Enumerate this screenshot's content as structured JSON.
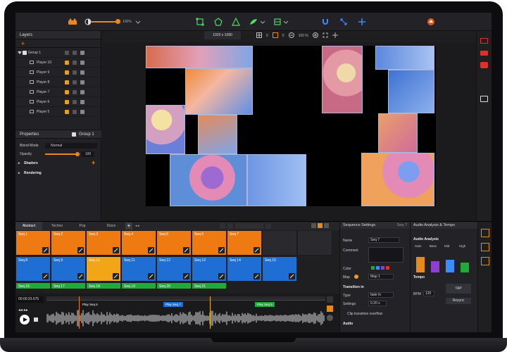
{
  "toolbar": {
    "zoom_percent": "100%",
    "resolution": "1920 x 1080",
    "canvas_zoom": "100 %",
    "x_label": "0",
    "y_label": "0",
    "tools": [
      "rect-tool-icon",
      "polygon-tool-icon",
      "triangle-tool-icon",
      "mask-tool-icon",
      "transform-tool-icon"
    ],
    "accent": "#e88a1a",
    "tool_color": "#4cd964",
    "snap_color": "#3b8cff"
  },
  "layers": {
    "title": "Layers",
    "group": {
      "name": "Group 1"
    },
    "items": [
      {
        "name": "Player 10"
      },
      {
        "name": "Player 9"
      },
      {
        "name": "Player 8"
      },
      {
        "name": "Player 7"
      },
      {
        "name": "Player 6"
      },
      {
        "name": "Player 5"
      }
    ]
  },
  "properties": {
    "title": "Properties",
    "target": "Group 1",
    "blend_mode_label": "Blend Mode",
    "blend_mode": "Normal",
    "opacity_label": "Opacity",
    "opacity": "100",
    "opacity_fraction": 1.0,
    "shaders": "Shaders",
    "rendering": "Rendering"
  },
  "bottom": {
    "tabs": [
      "Abstract",
      "Techno",
      "Pop",
      "Disco"
    ],
    "active_tab": "Abstract",
    "row1": [
      {
        "label": "Seq 1"
      },
      {
        "label": "Seq 2"
      },
      {
        "label": "Seq 3"
      },
      {
        "label": "Seq 4"
      },
      {
        "label": "Seq 5"
      },
      {
        "label": "Seq 6"
      },
      {
        "label": "Seq 7"
      }
    ],
    "row2": [
      {
        "label": "Seq 8"
      },
      {
        "label": "Seq 9"
      },
      {
        "label": "Seq 10"
      },
      {
        "label": "Seq 11"
      },
      {
        "label": "Seq 12"
      },
      {
        "label": "Seq 13"
      },
      {
        "label": "Seq 14"
      },
      {
        "label": "Seq 15"
      }
    ],
    "row3": [
      {
        "label": "Seq 16"
      },
      {
        "label": "Seq 17"
      },
      {
        "label": "Seq 18"
      },
      {
        "label": "Seq 19"
      },
      {
        "label": "Seq 20"
      },
      {
        "label": "Seq 21"
      }
    ],
    "colors": {
      "orange": "#f07a12",
      "blue": "#1f6ed4",
      "green": "#1faa3a",
      "yellow": "#f2a516"
    },
    "timecode": "00:00:23.675",
    "markers": [
      "Play Seq 6",
      "Play Seq 7",
      "Play Seq 5"
    ]
  },
  "sequence_settings": {
    "title": "Sequence Settings",
    "seq_ref": "Seq 7",
    "name_label": "Name",
    "name_value": "Seq 7",
    "comment_label": "Comment",
    "color_label": "Color",
    "map_label": "Map",
    "map_value": "Map 1",
    "transition_in": "Transition in",
    "type_label": "Type",
    "type_value": "fade fx",
    "settings_label": "Settings",
    "settings_value": "0.20 s",
    "clip_overflow": "Clip transition overflow",
    "audio": "Audio"
  },
  "audio_analysis": {
    "title": "Audio Analysis & Tempo",
    "section": "Audio Analysis",
    "bands": [
      "Gain",
      "Bass",
      "Mid",
      "High"
    ],
    "tempo": "Tempo",
    "bpm_label": "BPM",
    "bpm": "120",
    "tap": "TAP",
    "resync": "Resync"
  }
}
